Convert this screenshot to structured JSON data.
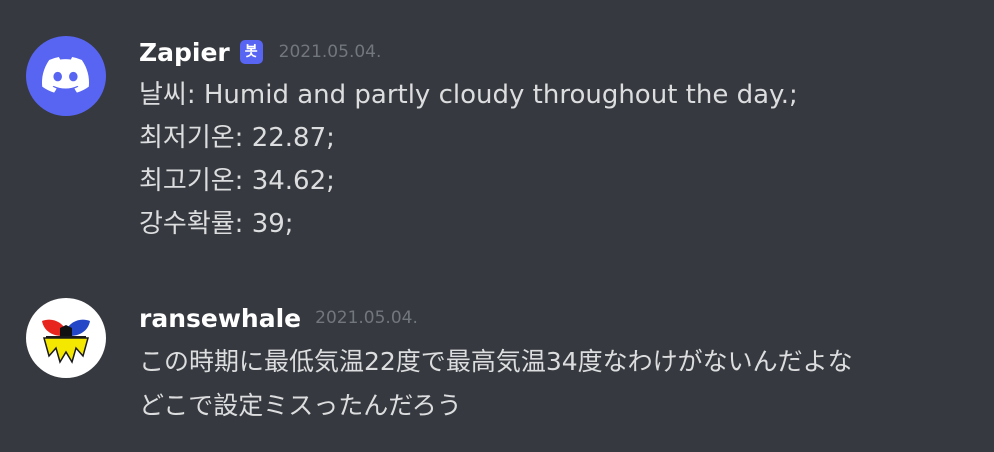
{
  "messages": [
    {
      "author": "Zapier",
      "bot_tag": "봇",
      "timestamp": "2021.05.04.",
      "avatar_icon": "discord-logo-icon",
      "lines": [
        "날씨: Humid and partly cloudy throughout the day.;",
        "최저기온: 22.87;",
        "최고기온: 34.62;",
        "강수확률: 39;"
      ]
    },
    {
      "author": "ransewhale",
      "timestamp": "2021.05.04.",
      "avatar_icon": "whale-avatar-icon",
      "lines": [
        "この時期に最低気温22度で最高気温34度なわけがないんだよな",
        "どこで設定ミスったんだろう"
      ]
    }
  ],
  "colors": {
    "background": "#36393f",
    "bot_tag": "#5865f2",
    "timestamp": "#72767d",
    "text": "#dcddde",
    "username": "#ffffff"
  }
}
